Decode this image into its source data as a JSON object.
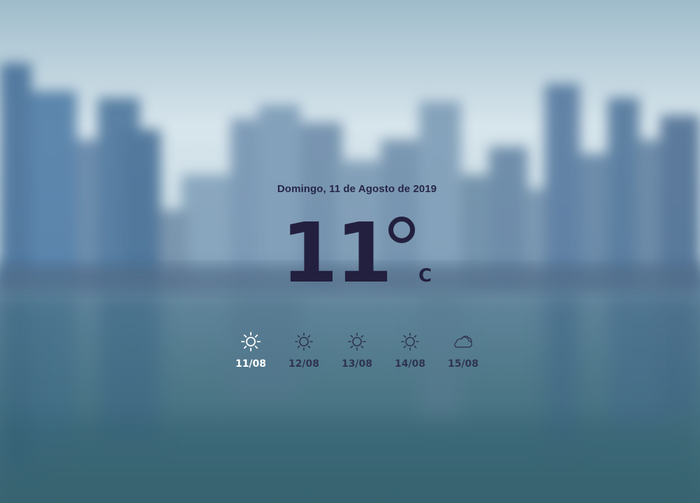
{
  "weather": {
    "date": "Domingo, 11 de Agosto de 2019",
    "temperature": "11",
    "unit": "C"
  },
  "forecast": [
    {
      "label": "11/08",
      "icon": "sun-icon",
      "active": true
    },
    {
      "label": "12/08",
      "icon": "sun-icon",
      "active": false
    },
    {
      "label": "13/08",
      "icon": "sun-icon",
      "active": false
    },
    {
      "label": "14/08",
      "icon": "sun-icon",
      "active": false
    },
    {
      "label": "15/08",
      "icon": "cloud-icon",
      "active": false
    }
  ],
  "colors": {
    "text_dark": "#23203f",
    "active_day": "#ffffff",
    "sky": "#dbe8ee",
    "water": "#3e6a7c"
  }
}
